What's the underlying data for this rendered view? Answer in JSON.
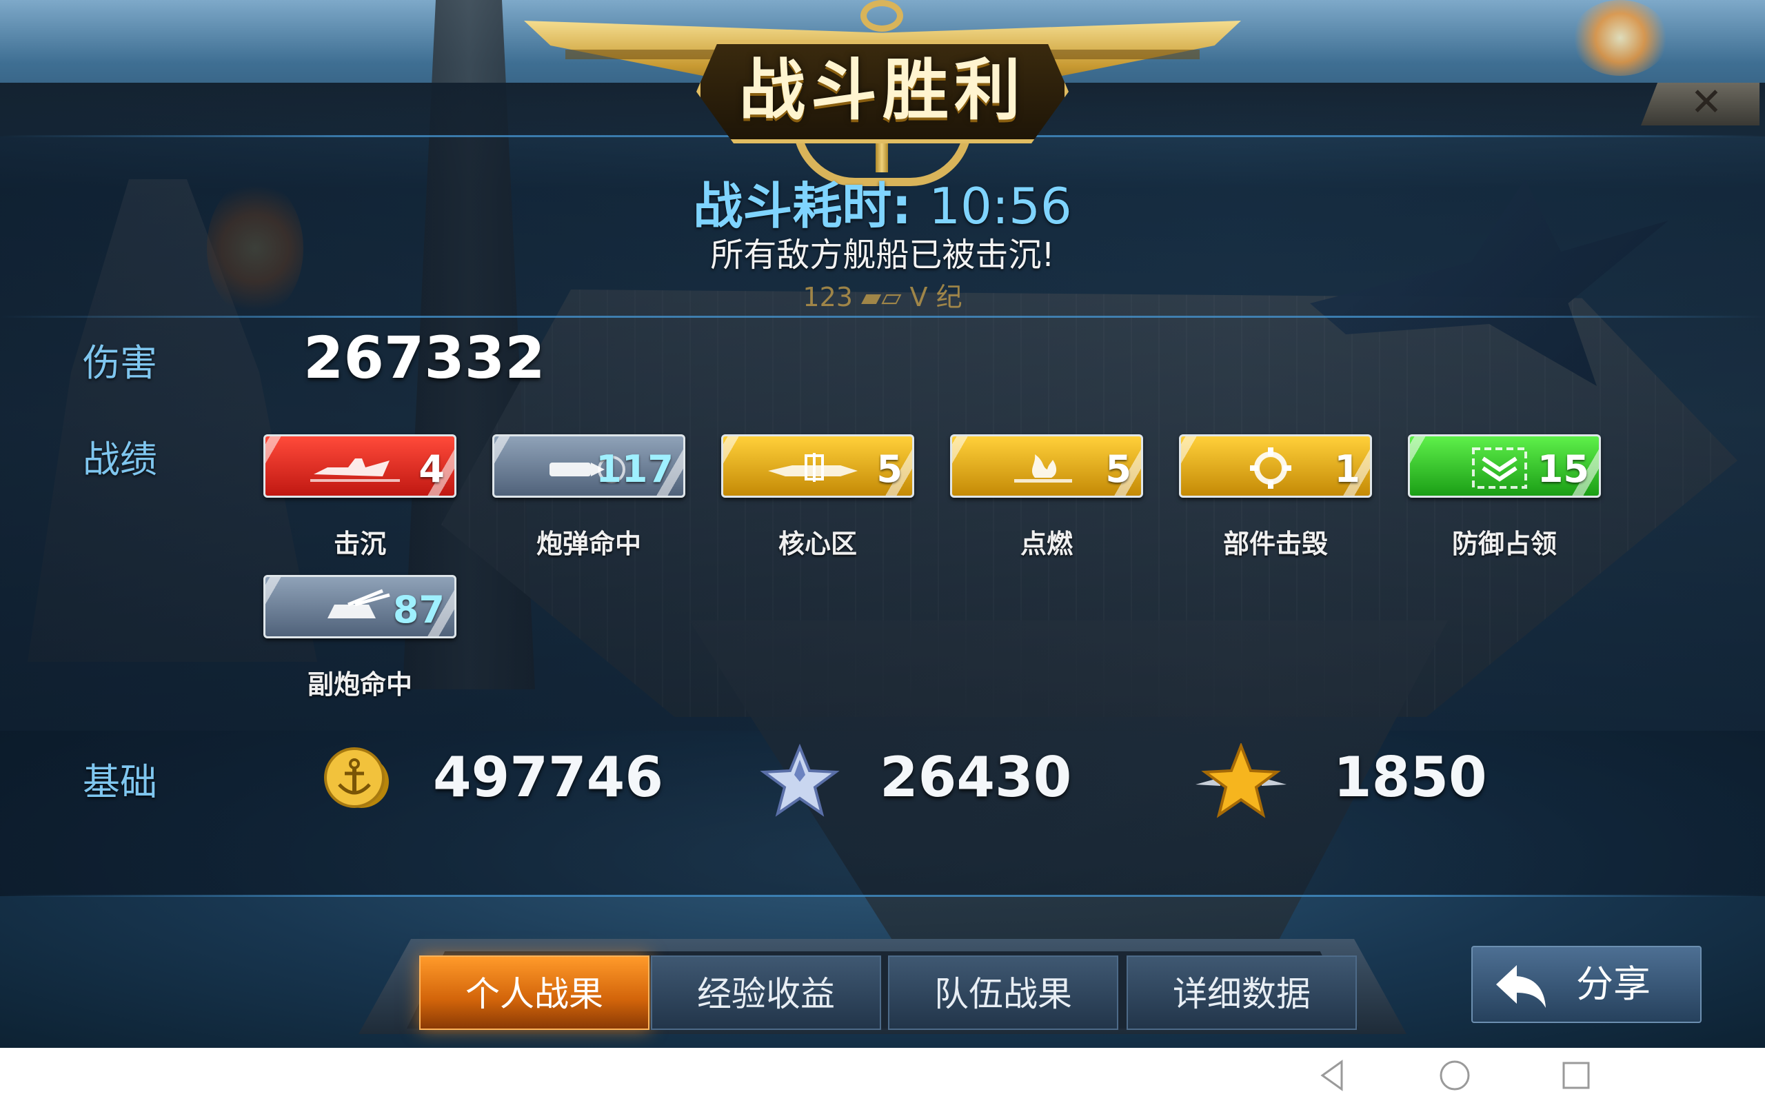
{
  "header": {
    "title": "战斗胜利",
    "close_glyph": "✕"
  },
  "summary": {
    "duration_label": "战斗耗时: ",
    "duration_value": "10:56",
    "subtitle": "所有敌方舰船已被击沉!",
    "faded_line": "123 ▰▱  V  纪"
  },
  "damage": {
    "label": "伤害",
    "value": "267332"
  },
  "record": {
    "label": "战绩",
    "stats": [
      {
        "label": "击沉",
        "value": "4",
        "color": "red",
        "icon": "sunk-ship-icon"
      },
      {
        "label": "炮弹命中",
        "value": "117",
        "color": "gray",
        "icon": "shell-hit-icon"
      },
      {
        "label": "核心区",
        "value": "5",
        "color": "gold",
        "icon": "core-zone-icon"
      },
      {
        "label": "点燃",
        "value": "5",
        "color": "gold",
        "icon": "fire-icon"
      },
      {
        "label": "部件击毁",
        "value": "1",
        "color": "gold",
        "icon": "gear-broken-icon"
      },
      {
        "label": "防御占领",
        "value": "15",
        "color": "green",
        "icon": "defense-capture-icon"
      },
      {
        "label": "副炮命中",
        "value": "87",
        "color": "gray",
        "icon": "secondary-gun-icon"
      }
    ]
  },
  "basic": {
    "label": "基础",
    "coins": "497746",
    "silver_exp": "26430",
    "gold_exp": "1850"
  },
  "tabs": [
    {
      "label": "个人战果",
      "active": true
    },
    {
      "label": "经验收益",
      "active": false
    },
    {
      "label": "队伍战果",
      "active": false
    },
    {
      "label": "详细数据",
      "active": false
    }
  ],
  "share": {
    "label": "分享"
  },
  "colors": {
    "accent_blue": "#7fc6ef",
    "active_tab": "#ff9a2a",
    "title_gold": "#e1bd62"
  }
}
